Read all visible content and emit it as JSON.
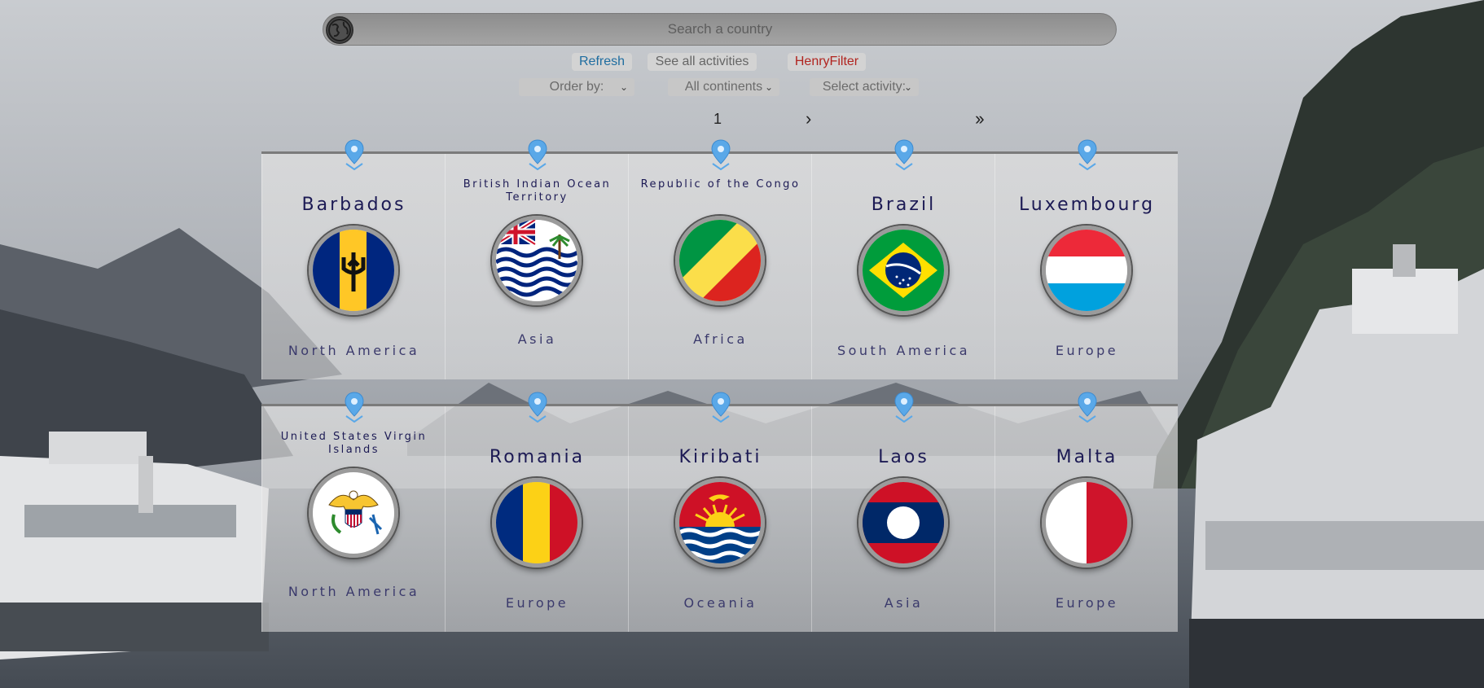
{
  "search": {
    "placeholder": "Search a country"
  },
  "buttons": {
    "refresh": "Refresh",
    "see_all": "See all activities",
    "henry": "HenryFilter"
  },
  "selects": {
    "order_by": "Order by:",
    "continents": "All continents",
    "activity": "Select activity:"
  },
  "pagination": {
    "current": "1",
    "next": "›",
    "last": "››"
  },
  "countries": [
    {
      "name": "Barbados",
      "continent": "North America",
      "flag": "barbados-flag-icon"
    },
    {
      "name": "British Indian Ocean Territory",
      "continent": "Asia",
      "flag": "british-indian-ocean-territory-flag-icon"
    },
    {
      "name": "Republic of the Congo",
      "continent": "Africa",
      "flag": "congo-flag-icon"
    },
    {
      "name": "Brazil",
      "continent": "South America",
      "flag": "brazil-flag-icon"
    },
    {
      "name": "Luxembourg",
      "continent": "Europe",
      "flag": "luxembourg-flag-icon"
    },
    {
      "name": "United States Virgin Islands",
      "continent": "North America",
      "flag": "usvi-flag-icon"
    },
    {
      "name": "Romania",
      "continent": "Europe",
      "flag": "romania-flag-icon"
    },
    {
      "name": "Kiribati",
      "continent": "Oceania",
      "flag": "kiribati-flag-icon"
    },
    {
      "name": "Laos",
      "continent": "Asia",
      "flag": "laos-flag-icon"
    },
    {
      "name": "Malta",
      "continent": "Europe",
      "flag": "malta-flag-icon"
    }
  ],
  "colors": {
    "pin": "#5aa8e8",
    "name_text": "#1c1a54",
    "refresh": "#1f6da0",
    "henry": "#b1241f"
  }
}
